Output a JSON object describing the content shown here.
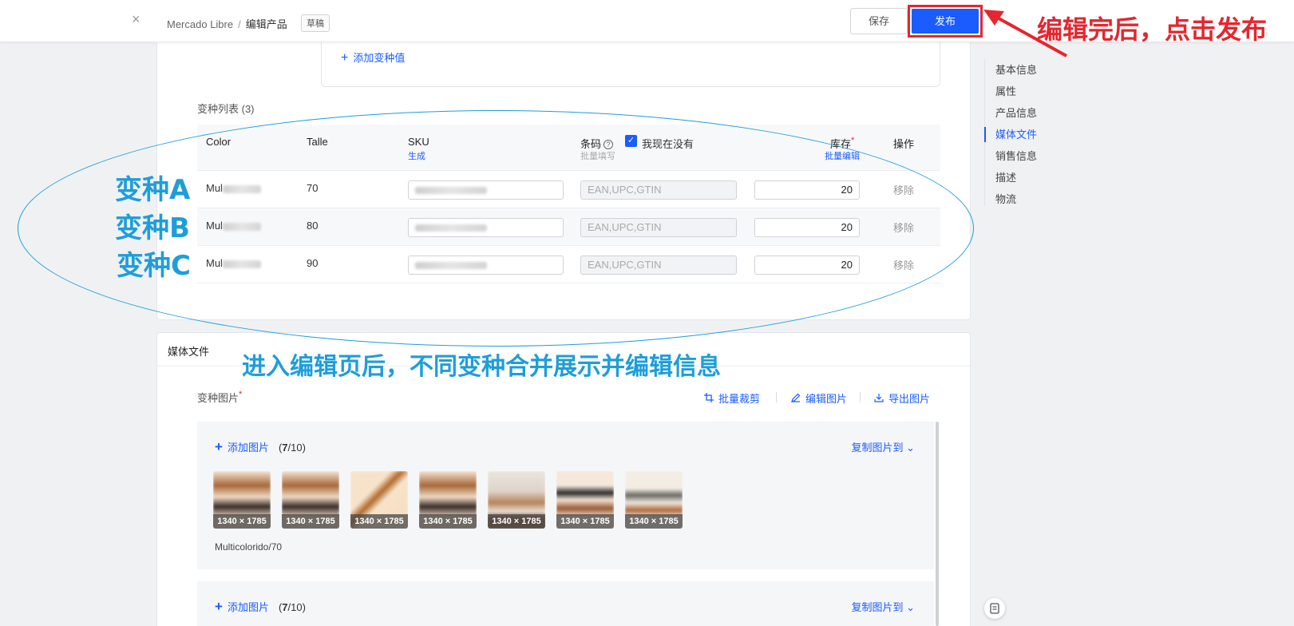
{
  "header": {
    "close_glyph": "×",
    "breadcrumb_root": "Mercado Libre",
    "breadcrumb_sep": "/",
    "breadcrumb_current": "编辑产品",
    "draft_badge": "草稿",
    "save_label": "保存",
    "publish_label": "发布"
  },
  "annotations": {
    "publish_hint": "编辑完后，点击发布",
    "merge_hint": "进入编辑页后，不同变种合并展示并编辑信息",
    "variant_labels": [
      "变种A",
      "变种B",
      "变种C"
    ]
  },
  "right_nav": {
    "items": [
      {
        "label": "基本信息",
        "active": false
      },
      {
        "label": "属性",
        "active": false
      },
      {
        "label": "产品信息",
        "active": false
      },
      {
        "label": "媒体文件",
        "active": true
      },
      {
        "label": "销售信息",
        "active": false
      },
      {
        "label": "描述",
        "active": false
      },
      {
        "label": "物流",
        "active": false
      }
    ]
  },
  "variants": {
    "add_value_label": "添加变种值",
    "list_title": "变种列表 (3)",
    "columns": {
      "color": "Color",
      "talle": "Talle",
      "sku": "SKU",
      "sku_sub": "生成",
      "barcode": "条码",
      "barcode_sub": "批量填写",
      "barcode_check_label": "我现在没有",
      "stock": "库存",
      "stock_sub": "批量编辑",
      "actions": "操作"
    },
    "rows": [
      {
        "color": "Mul",
        "talle": "70",
        "ean_placeholder": "EAN,UPC,GTIN",
        "stock": "20",
        "remove": "移除"
      },
      {
        "color": "Mul",
        "talle": "80",
        "ean_placeholder": "EAN,UPC,GTIN",
        "stock": "20",
        "remove": "移除"
      },
      {
        "color": "Mul",
        "talle": "90",
        "ean_placeholder": "EAN,UPC,GTIN",
        "stock": "20",
        "remove": "移除"
      }
    ]
  },
  "media": {
    "section_title": "媒体文件",
    "variant_images_title": "变种图片",
    "tools": {
      "batch_crop": "批量裁剪",
      "edit_images": "编辑图片",
      "export_images": "导出图片"
    },
    "panels": [
      {
        "add_label": "添加图片",
        "count_current": "7",
        "count_total": "/10",
        "copy_label": "复制图片到",
        "variant_label": "Multicolorido/70",
        "thumbs": [
          "1340 × 1785",
          "1340 × 1785",
          "1340 × 1785",
          "1340 × 1785",
          "1340 × 1785",
          "1340 × 1785",
          "1340 × 1785"
        ]
      },
      {
        "add_label": "添加图片",
        "count_current": "7",
        "count_total": "/10",
        "copy_label": "复制图片到"
      }
    ]
  },
  "colors": {
    "accent": "#1a5cff",
    "annotation_red": "#e5262e",
    "annotation_blue": "#1e9ed8"
  }
}
